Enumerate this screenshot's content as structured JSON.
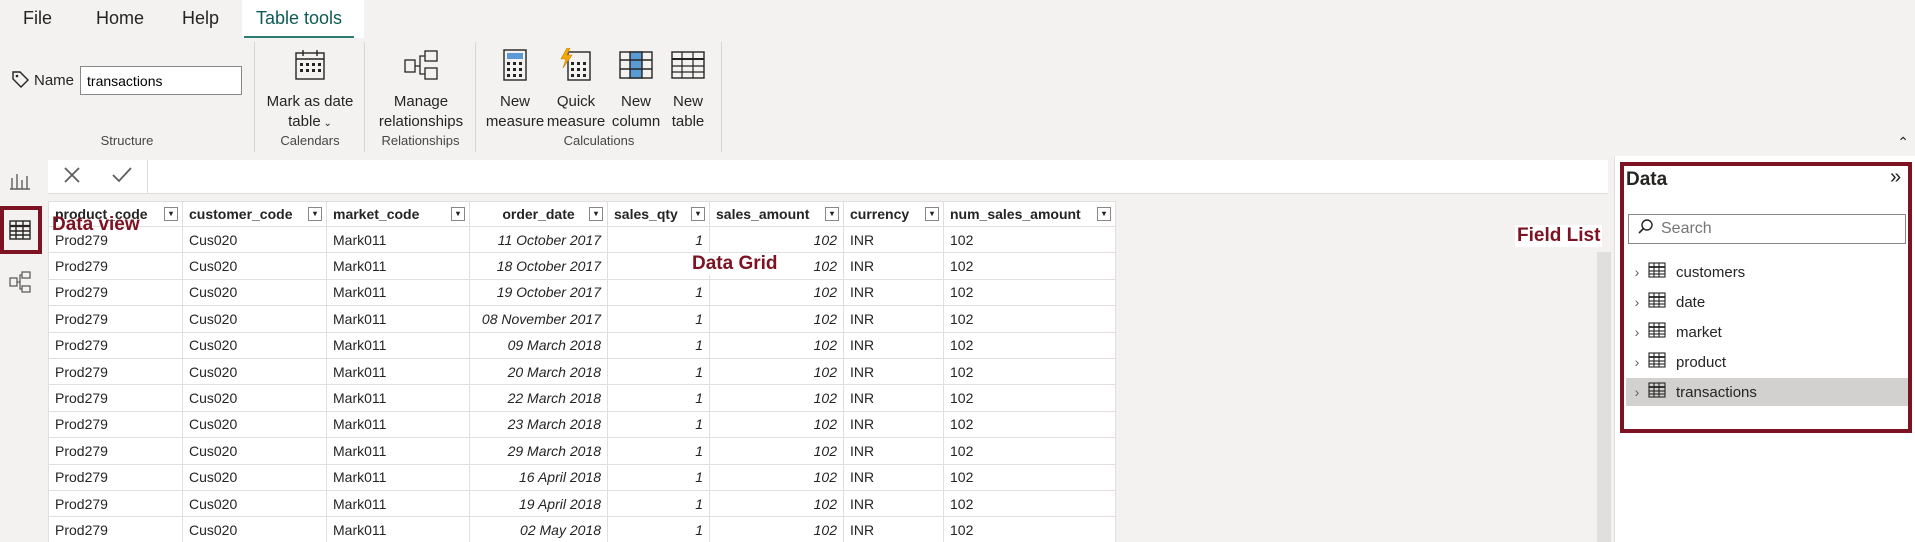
{
  "tabs": [
    "File",
    "Home",
    "Help",
    "Table tools"
  ],
  "ribbon": {
    "name_label": "Name",
    "name_value": "transactions",
    "groups": {
      "structure": "Structure",
      "calendars": "Calendars",
      "relationships": "Relationships",
      "calculations": "Calculations"
    },
    "buttons": {
      "mark_date_1": "Mark as date",
      "mark_date_2": "table",
      "manage_1": "Manage",
      "manage_2": "relationships",
      "new_measure_1": "New",
      "new_measure_2": "measure",
      "quick_measure_1": "Quick",
      "quick_measure_2": "measure",
      "new_column_1": "New",
      "new_column_2": "column",
      "new_table_1": "New",
      "new_table_2": "table"
    }
  },
  "grid": {
    "columns": [
      "product_code",
      "customer_code",
      "market_code",
      "order_date",
      "sales_qty",
      "sales_amount",
      "currency",
      "num_sales_amount"
    ],
    "rows": [
      [
        "Prod279",
        "Cus020",
        "Mark011",
        "11 October 2017",
        "1",
        "102",
        "INR",
        "102"
      ],
      [
        "Prod279",
        "Cus020",
        "Mark011",
        "18 October 2017",
        "1",
        "102",
        "INR",
        "102"
      ],
      [
        "Prod279",
        "Cus020",
        "Mark011",
        "19 October 2017",
        "1",
        "102",
        "INR",
        "102"
      ],
      [
        "Prod279",
        "Cus020",
        "Mark011",
        "08 November 2017",
        "1",
        "102",
        "INR",
        "102"
      ],
      [
        "Prod279",
        "Cus020",
        "Mark011",
        "09 March 2018",
        "1",
        "102",
        "INR",
        "102"
      ],
      [
        "Prod279",
        "Cus020",
        "Mark011",
        "20 March 2018",
        "1",
        "102",
        "INR",
        "102"
      ],
      [
        "Prod279",
        "Cus020",
        "Mark011",
        "22 March 2018",
        "1",
        "102",
        "INR",
        "102"
      ],
      [
        "Prod279",
        "Cus020",
        "Mark011",
        "23 March 2018",
        "1",
        "102",
        "INR",
        "102"
      ],
      [
        "Prod279",
        "Cus020",
        "Mark011",
        "29 March 2018",
        "1",
        "102",
        "INR",
        "102"
      ],
      [
        "Prod279",
        "Cus020",
        "Mark011",
        "16 April 2018",
        "1",
        "102",
        "INR",
        "102"
      ],
      [
        "Prod279",
        "Cus020",
        "Mark011",
        "19 April 2018",
        "1",
        "102",
        "INR",
        "102"
      ],
      [
        "Prod279",
        "Cus020",
        "Mark011",
        "02 May 2018",
        "1",
        "102",
        "INR",
        "102"
      ]
    ]
  },
  "annotations": {
    "data_view": "Data view",
    "data_grid": "Data Grid",
    "field_list": "Field List"
  },
  "data_pane": {
    "title": "Data",
    "search_placeholder": "Search",
    "tables": [
      "customers",
      "date",
      "market",
      "product",
      "transactions"
    ]
  },
  "colors": {
    "accent": "#2d7c74",
    "annotation": "#7c1222",
    "selected_row": "#d3d1cf"
  }
}
